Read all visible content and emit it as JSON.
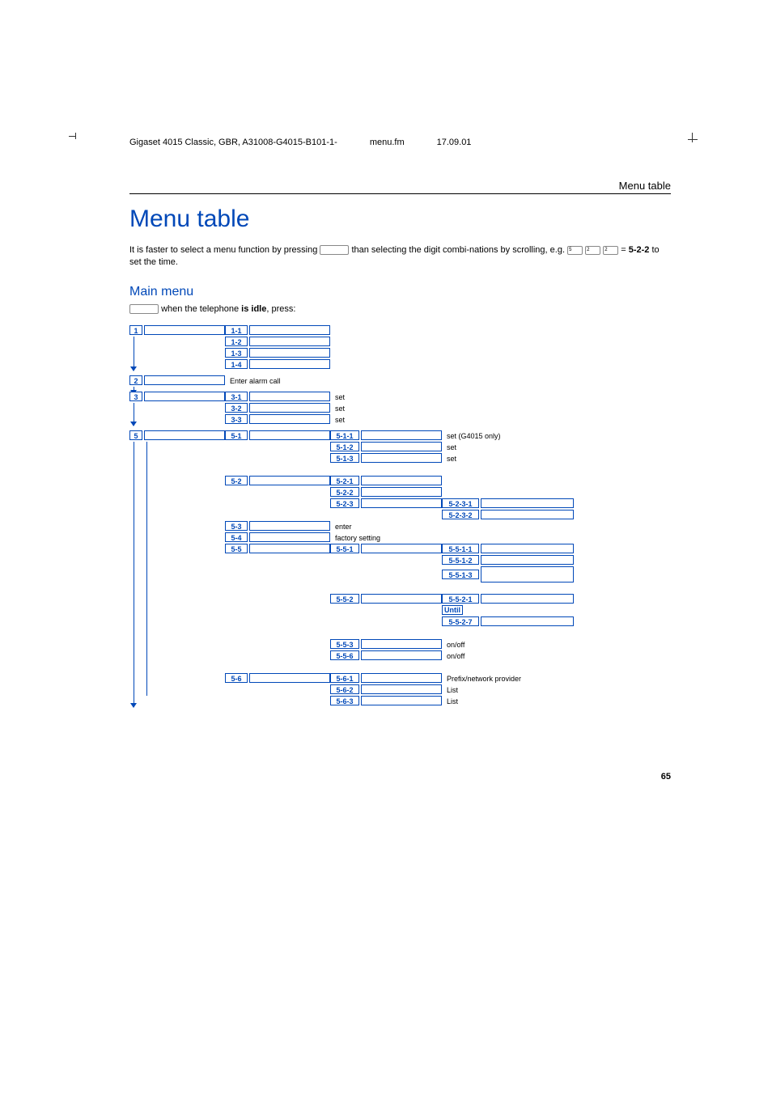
{
  "header": {
    "left": "Gigaset 4015 Classic, GBR, A31008-G4015-B101-1-",
    "mid": "menu.fm",
    "right": "17.09.01"
  },
  "section_header": "Menu table",
  "title": "Menu table",
  "intro_part1": "It is faster to select a menu function by pressing ",
  "intro_part2": " than selecting the digit combi-nations by scrolling, e.g. ",
  "intro_keys": "5-2-2",
  "intro_part3": " to set the time.",
  "main_menu_heading": "Main menu",
  "idle_text": " when the telephone ",
  "idle_bold": "is idle",
  "idle_suffix": ", press:",
  "tree": {
    "r1": "1",
    "r1_1": "1-1",
    "r1_2": "1-2",
    "r1_3": "1-3",
    "r1_4": "1-4",
    "r2": "2",
    "r2_desc": "Enter alarm call",
    "r3": "3",
    "r3_1": "3-1",
    "r3_2": "3-2",
    "r3_3": "3-3",
    "r3_1d": "set",
    "r3_2d": "set",
    "r3_3d": "set",
    "r5": "5",
    "r5_1": "5-1",
    "r5_1_1": "5-1-1",
    "r5_1_2": "5-1-2",
    "r5_1_3": "5-1-3",
    "r5_1_1d": "set (G4015 only)",
    "r5_1_2d": "set",
    "r5_1_3d": "set",
    "r5_2": "5-2",
    "r5_2_1": "5-2-1",
    "r5_2_2": "5-2-2",
    "r5_2_3": "5-2-3",
    "r5_2_3_1": "5-2-3-1",
    "r5_2_3_2": "5-2-3-2",
    "r5_3": "5-3",
    "r5_3d": "enter",
    "r5_4": "5-4",
    "r5_4d": "factory setting",
    "r5_5": "5-5",
    "r5_5_1": "5-5-1",
    "r5_5_1_1": "5-5-1-1",
    "r5_5_1_2": "5-5-1-2",
    "r5_5_1_3": "5-5-1-3",
    "r5_5_2": "5-5-2",
    "r5_5_2_1": "5-5-2-1",
    "r5_5_2_until": "Until",
    "r5_5_2_7": "5-5-2-7",
    "r5_5_3": "5-5-3",
    "r5_5_3d": "on/off",
    "r5_5_6": "5-5-6",
    "r5_5_6d": "on/off",
    "r5_6": "5-6",
    "r5_6_1": "5-6-1",
    "r5_6_1d": "Prefix/network provider",
    "r5_6_2": "5-6-2",
    "r5_6_2d": "List",
    "r5_6_3": "5-6-3",
    "r5_6_3d": "List"
  },
  "page_number": "65"
}
